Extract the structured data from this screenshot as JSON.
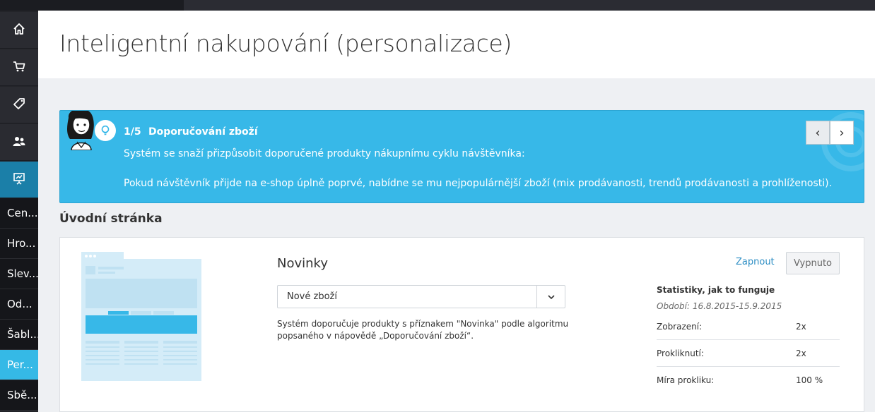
{
  "sidebar": {
    "icons": [
      {
        "name": "home-icon"
      },
      {
        "name": "cart-icon"
      },
      {
        "name": "tag-icon"
      },
      {
        "name": "users-icon"
      },
      {
        "name": "presentation-icon"
      }
    ],
    "items": [
      {
        "label": "Cen..."
      },
      {
        "label": "Hro..."
      },
      {
        "label": "Slev..."
      },
      {
        "label": "Od..."
      },
      {
        "label": "Šabl..."
      },
      {
        "label": "Per..."
      },
      {
        "label": "Sbě..."
      }
    ]
  },
  "header": {
    "title": "Inteligentní nakupování (personalizace)"
  },
  "banner": {
    "step": "1/5",
    "title": "Doporučování zboží",
    "line1": "Systém se snaží přizpůsobit doporučené produkty nákupnímu cyklu návštěvníka:",
    "line2": "Pokud návštěvník přijde na e-shop úplně poprvé, nabídne se mu nejpopulárnější zboží (mix prodávanosti, trendů prodávanosti a prohlíženosti).",
    "prev": "‹",
    "next": "›"
  },
  "section": {
    "title": "Úvodní stránka"
  },
  "card": {
    "title": "Novinky",
    "select_value": "Nové zboží",
    "description": "Systém doporučuje produkty s příznakem \"Novinka\" podle algoritmu popsaného v nápovědě „Doporučování zboží“.",
    "on_label": "Zapnout",
    "off_label": "Vypnuto",
    "stats": {
      "title": "Statistiky, jak to funguje",
      "period": "Období: 16.8.2015-15.9.2015",
      "rows": [
        {
          "label": "Zobrazení:",
          "value": "2x"
        },
        {
          "label": "Prokliknutí:",
          "value": "2x"
        },
        {
          "label": "Míra prokliku:",
          "value": "100 %"
        }
      ]
    }
  },
  "colors": {
    "accent": "#37b8e8",
    "sidebar_active": "#1b7fa8",
    "link": "#2d8ec4"
  }
}
